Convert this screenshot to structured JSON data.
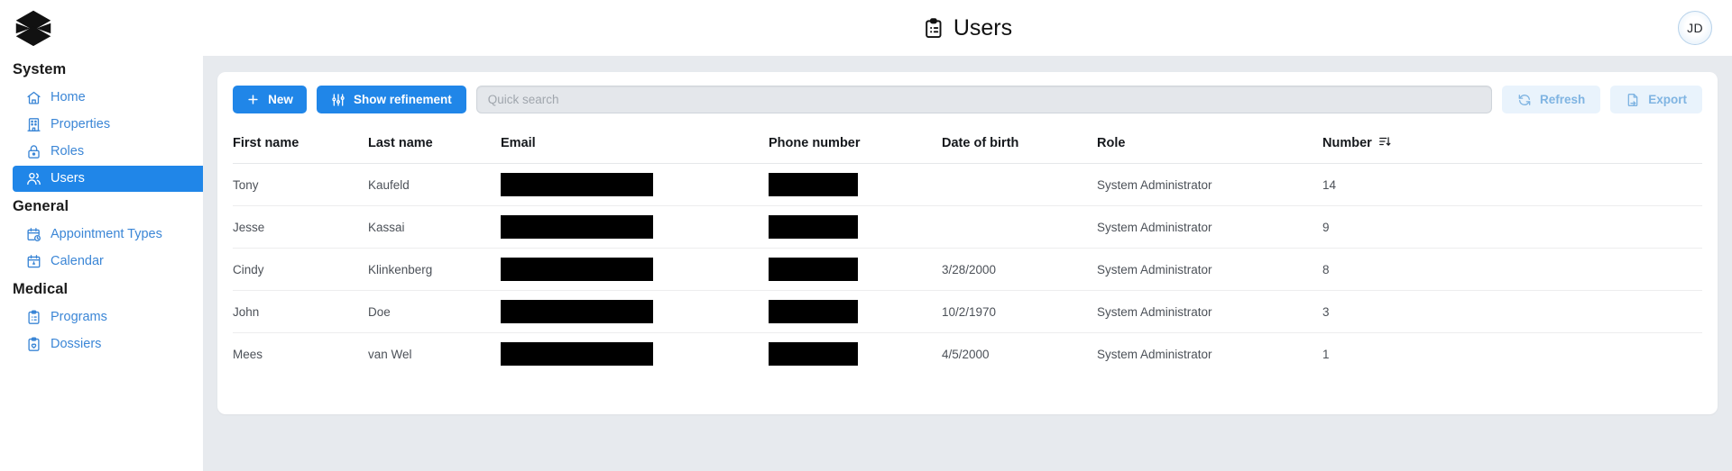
{
  "app": {
    "logo_name": "hexagon-logo",
    "accent_color": "#2086e8",
    "link_color": "#3b86d6",
    "content_bg": "#e7eaee"
  },
  "header": {
    "title": "Users",
    "title_icon": "clipboard-icon",
    "avatar_initials": "JD"
  },
  "sidebar": {
    "groups": [
      {
        "title": "System",
        "items": [
          {
            "label": "Home",
            "icon": "home-icon",
            "active": false
          },
          {
            "label": "Properties",
            "icon": "building-icon",
            "active": false
          },
          {
            "label": "Roles",
            "icon": "lock-icon",
            "active": false
          },
          {
            "label": "Users",
            "icon": "users-icon",
            "active": true
          }
        ]
      },
      {
        "title": "General",
        "items": [
          {
            "label": "Appointment Types",
            "icon": "calendar-clock-icon",
            "active": false
          },
          {
            "label": "Calendar",
            "icon": "calendar-icon",
            "active": false
          }
        ]
      },
      {
        "title": "Medical",
        "items": [
          {
            "label": "Programs",
            "icon": "clipboard-list-icon",
            "active": false
          },
          {
            "label": "Dossiers",
            "icon": "clipboard-heart-icon",
            "active": false
          }
        ]
      }
    ]
  },
  "toolbar": {
    "new_label": "New",
    "new_icon": "plus-icon",
    "refinement_label": "Show refinement",
    "refinement_icon": "sliders-icon",
    "search_value": "",
    "search_placeholder": "Quick search",
    "refresh_label": "Refresh",
    "refresh_icon": "refresh-icon",
    "export_label": "Export",
    "export_icon": "file-export-icon"
  },
  "table": {
    "columns": [
      {
        "key": "first_name",
        "label": "First name",
        "sorted": false
      },
      {
        "key": "last_name",
        "label": "Last name",
        "sorted": false
      },
      {
        "key": "email",
        "label": "Email",
        "sorted": false
      },
      {
        "key": "phone_number",
        "label": "Phone number",
        "sorted": false
      },
      {
        "key": "date_of_birth",
        "label": "Date of birth",
        "sorted": false
      },
      {
        "key": "role",
        "label": "Role",
        "sorted": false
      },
      {
        "key": "number",
        "label": "Number",
        "sorted": true,
        "sort_icon": "sort-descending-icon"
      }
    ],
    "rows": [
      {
        "first_name": "Tony",
        "last_name": "Kaufeld",
        "email": "",
        "email_redacted": true,
        "phone_number": "",
        "phone_redacted": true,
        "date_of_birth": "",
        "role": "System Administrator",
        "number": "14"
      },
      {
        "first_name": "Jesse",
        "last_name": "Kassai",
        "email": "",
        "email_redacted": true,
        "phone_number": "",
        "phone_redacted": true,
        "date_of_birth": "",
        "role": "System Administrator",
        "number": "9"
      },
      {
        "first_name": "Cindy",
        "last_name": "Klinkenberg",
        "email": "",
        "email_redacted": true,
        "phone_number": "",
        "phone_redacted": true,
        "date_of_birth": "3/28/2000",
        "role": "System Administrator",
        "number": "8"
      },
      {
        "first_name": "John",
        "last_name": "Doe",
        "email": "",
        "email_redacted": true,
        "phone_number": "",
        "phone_redacted": true,
        "date_of_birth": "10/2/1970",
        "role": "System Administrator",
        "number": "3"
      },
      {
        "first_name": "Mees",
        "last_name": "van Wel",
        "email": "",
        "email_redacted": true,
        "phone_number": "",
        "phone_redacted": true,
        "date_of_birth": "4/5/2000",
        "role": "System Administrator",
        "number": "1"
      }
    ]
  }
}
